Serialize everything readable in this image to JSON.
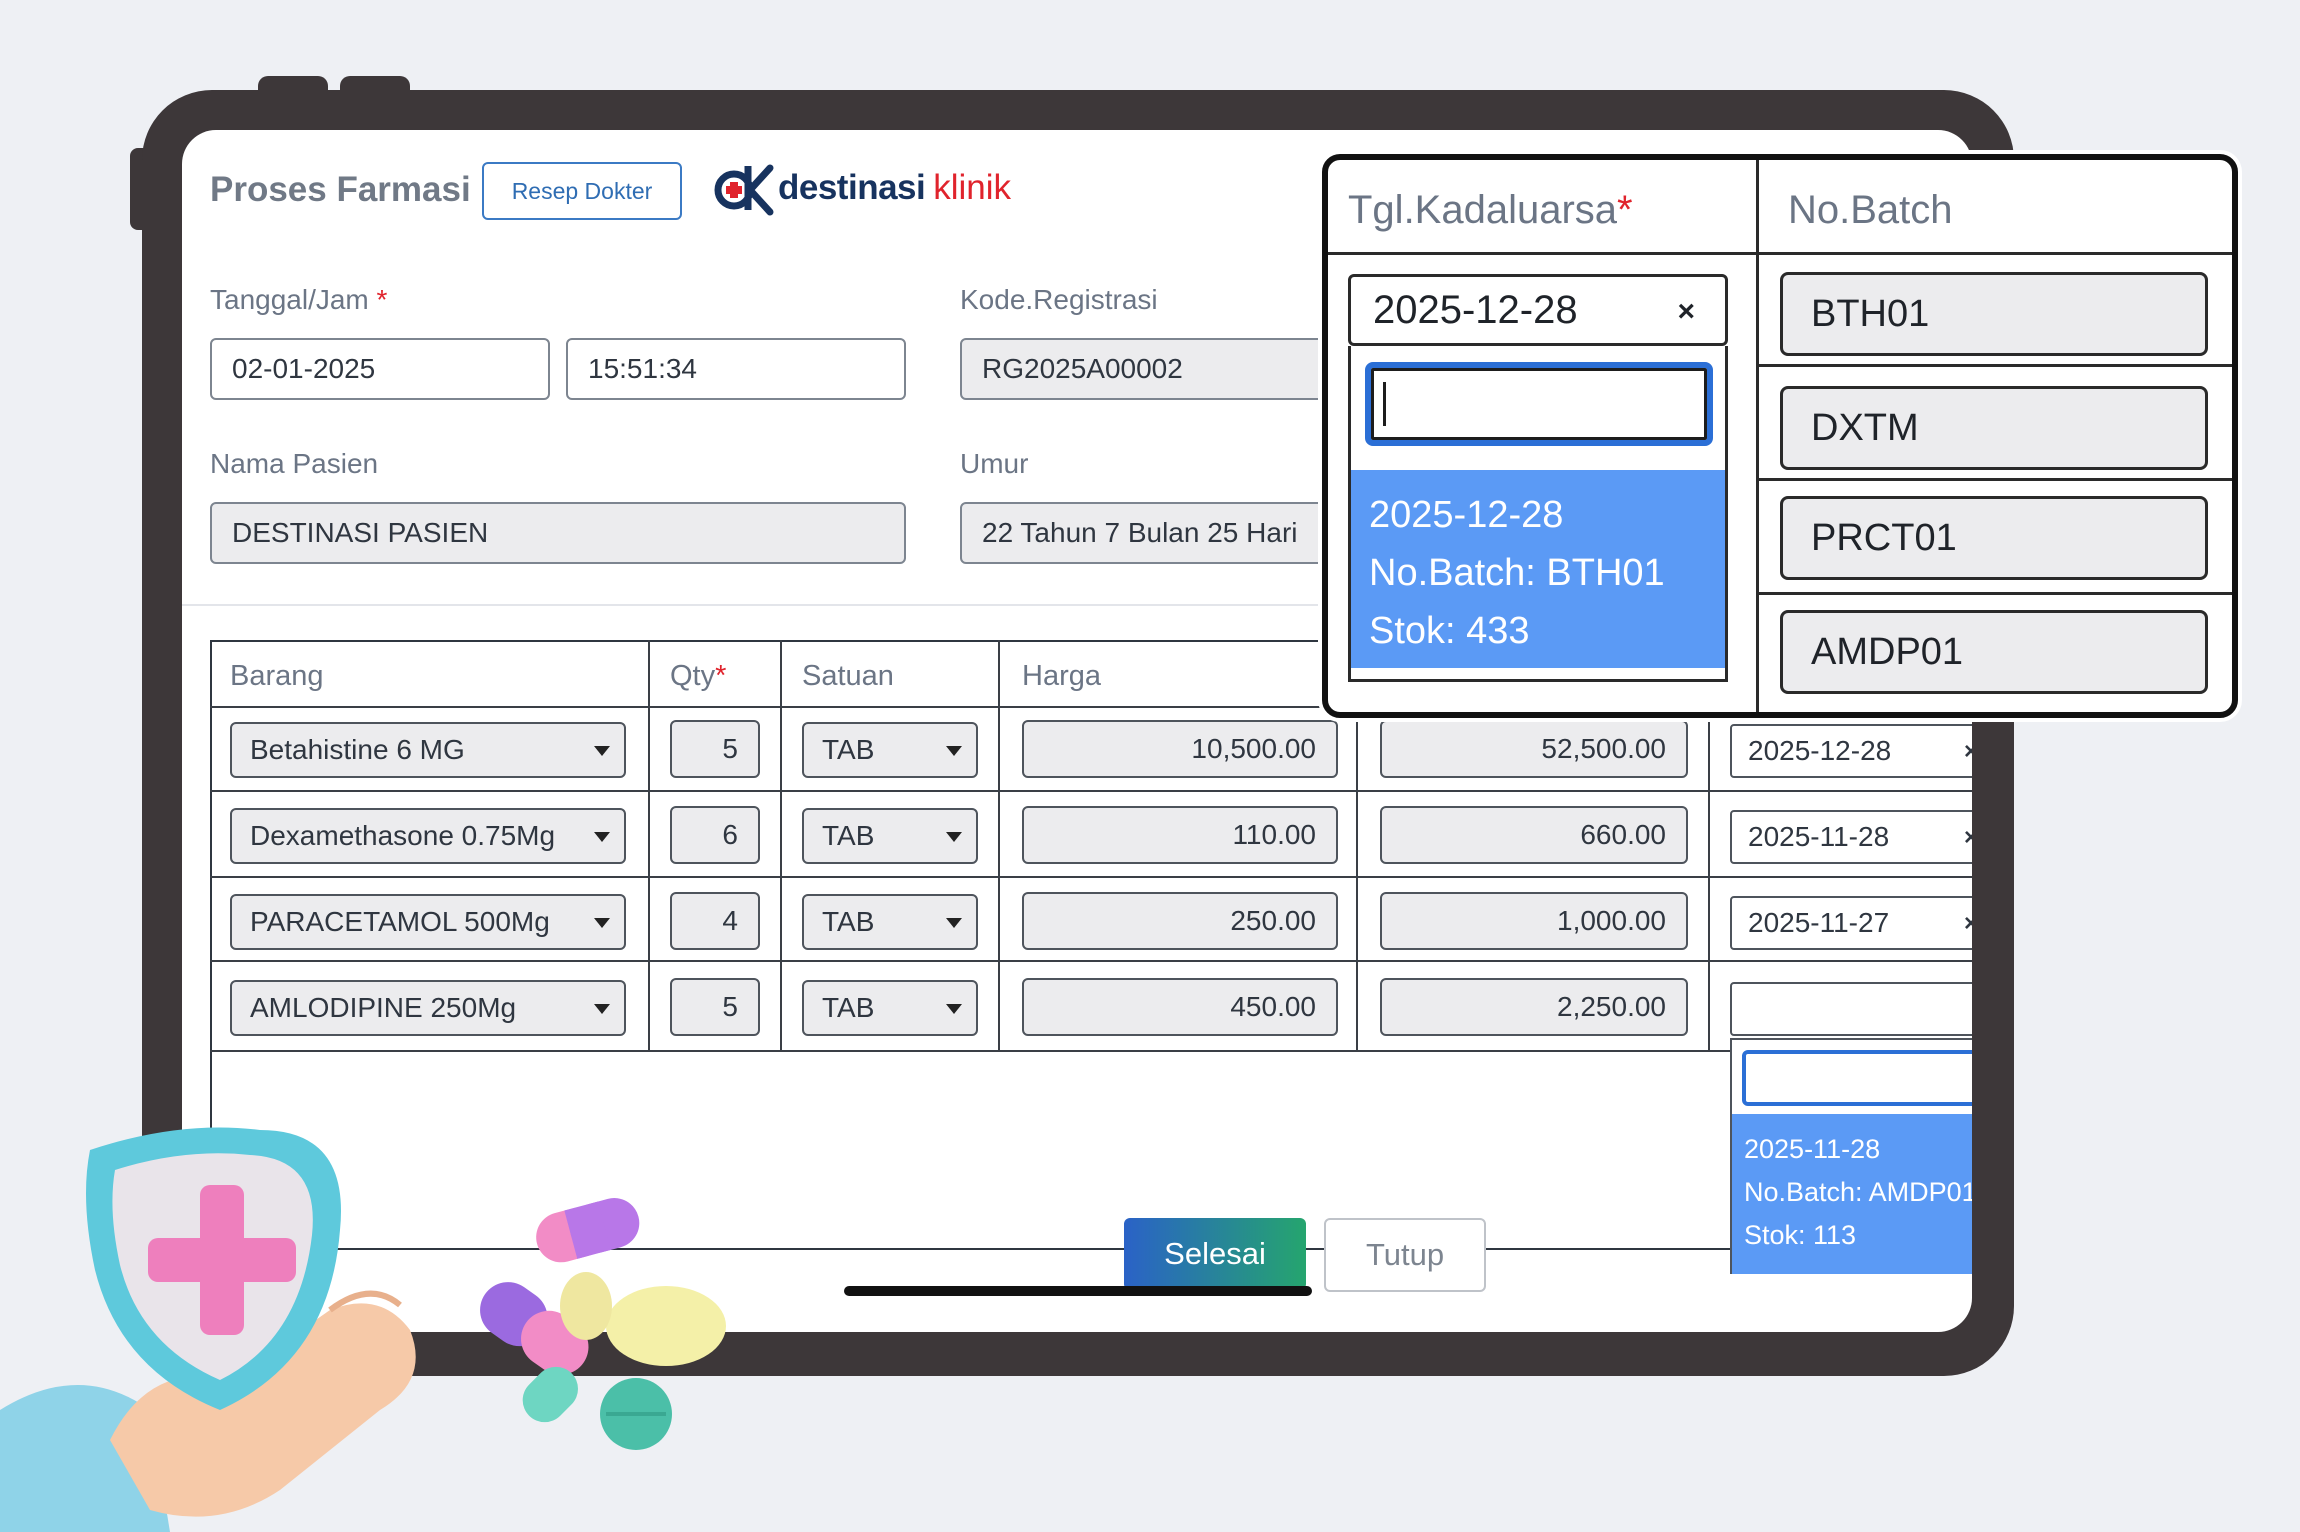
{
  "header": {
    "title": "Proses Farmasi",
    "resep_button": "Resep Dokter",
    "logo_brand": "destinasi",
    "logo_brand2": "klinik"
  },
  "form": {
    "tanggal_label": "Tanggal/Jam",
    "tanggal_value": "02-01-2025",
    "jam_value": "15:51:34",
    "kode_label": "Kode.Registrasi",
    "kode_value": "RG2025A00002",
    "nama_label": "Nama Pasien",
    "nama_value": "DESTINASI PASIEN",
    "umur_label": "Umur",
    "umur_value": "22 Tahun 7 Bulan 25 Hari",
    "required_mark": "*"
  },
  "table": {
    "headers": {
      "barang": "Barang",
      "qty": "Qty",
      "satuan": "Satuan",
      "harga": "Harga"
    },
    "rows": [
      {
        "barang": "Betahistine 6 MG",
        "qty": "5",
        "satuan": "TAB",
        "harga": "10,500.00",
        "total": "52,500.00",
        "kadaluarsa": "2025-12-28"
      },
      {
        "barang": "Dexamethasone 0.75Mg",
        "qty": "6",
        "satuan": "TAB",
        "harga": "110.00",
        "total": "660.00",
        "kadaluarsa": "2025-11-28"
      },
      {
        "barang": "PARACETAMOL 500Mg",
        "qty": "4",
        "satuan": "TAB",
        "harga": "250.00",
        "total": "1,000.00",
        "kadaluarsa": "2025-11-27"
      },
      {
        "barang": "AMLODIPINE 250Mg",
        "qty": "5",
        "satuan": "TAB",
        "harga": "450.00",
        "total": "2,250.00",
        "kadaluarsa": ""
      }
    ],
    "clear_glyph": "×",
    "dropdown_option": {
      "date": "2025-11-28",
      "batch": "No.Batch: AMDP01",
      "stok": "Stok: 113"
    }
  },
  "footer": {
    "selesai": "Selesai",
    "tutup": "Tutup"
  },
  "zoom": {
    "col_kadaluarsa": "Tgl.Kadaluarsa",
    "col_batch": "No.Batch",
    "date_value": "2025-12-28",
    "option": {
      "date": "2025-12-28",
      "batch": "No.Batch: BTH01",
      "stok": "Stok: 433"
    },
    "batches": [
      "BTH01",
      "DXTM",
      "PRCT01",
      "AMDP01"
    ]
  },
  "colors": {
    "frame": "#3d3739",
    "accent_blue": "#2b6fd6",
    "option_blue": "#5b9af5",
    "required_red": "#e0232c",
    "selesai_gradient": [
      "#2a62c7",
      "#25a56e"
    ]
  },
  "icons": [
    "dropdown-caret-icon",
    "clear-icon",
    "shield-cross-icon",
    "pills-icon",
    "logo-dk-icon"
  ]
}
